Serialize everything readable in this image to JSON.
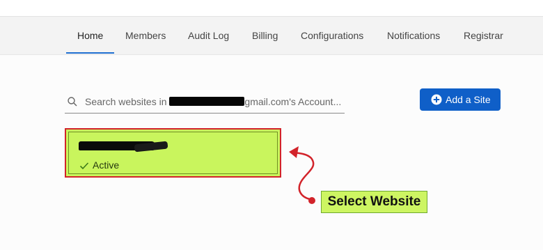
{
  "nav": {
    "tabs": [
      "Home",
      "Members",
      "Audit Log",
      "Billing",
      "Configurations",
      "Notifications",
      "Registrar"
    ],
    "active_tab": "Home"
  },
  "search": {
    "prefix": "Search websites in",
    "suffix": "gmail.com's Account..."
  },
  "add_site": {
    "label": "Add a Site",
    "icon": "plus-circle-icon"
  },
  "site": {
    "status": "Active",
    "status_icon": "check-icon"
  },
  "annotation": {
    "text": "Select Website",
    "highlight_color": "#c9f55d",
    "border_color": "#d2232a"
  },
  "colors": {
    "accent": "#0f5fc8",
    "tab_underline": "#1f6fd1"
  }
}
